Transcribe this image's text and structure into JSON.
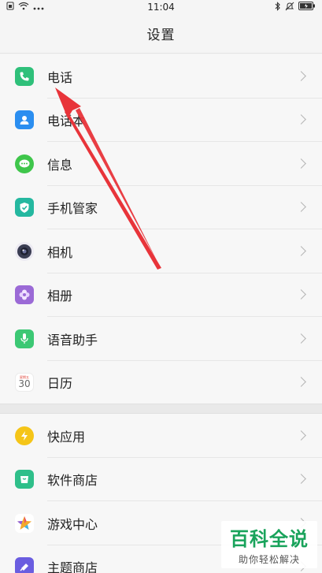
{
  "status_bar": {
    "time": "11:04",
    "left_icons": [
      "sim-icon",
      "wifi-icon",
      "more-dots-icon"
    ],
    "right_icons": [
      "bluetooth-icon",
      "mute-icon",
      "battery-icon"
    ]
  },
  "header": {
    "title": "设置"
  },
  "groups": [
    {
      "items": [
        {
          "label": "电话",
          "icon": "phone-icon",
          "color": "#2fc07a"
        },
        {
          "label": "电话本",
          "icon": "contacts-icon",
          "color": "#2b8ef0"
        },
        {
          "label": "信息",
          "icon": "messages-icon",
          "color": "#3fc64b"
        },
        {
          "label": "手机管家",
          "icon": "phone-manager-icon",
          "color": "#25b8a0"
        },
        {
          "label": "相机",
          "icon": "camera-icon",
          "color": "#3a3d52"
        },
        {
          "label": "相册",
          "icon": "gallery-icon",
          "color": "#9b6ad6"
        },
        {
          "label": "语音助手",
          "icon": "voice-assistant-icon",
          "color": "#3cc874"
        },
        {
          "label": "日历",
          "icon": "calendar-icon",
          "color": "#ffffff",
          "calendar_day": "30",
          "calendar_top": "星期五"
        }
      ]
    },
    {
      "items": [
        {
          "label": "快应用",
          "icon": "quick-app-icon",
          "color": "#f5c518"
        },
        {
          "label": "软件商店",
          "icon": "app-store-icon",
          "color": "#2fbf8a"
        },
        {
          "label": "游戏中心",
          "icon": "game-center-icon",
          "color": "#ffffff"
        },
        {
          "label": "主题商店",
          "icon": "theme-store-icon",
          "color": "#6a5de0"
        }
      ]
    }
  ],
  "annotation": {
    "arrow_color": "#e8343a"
  },
  "watermark": {
    "main": "百科全说",
    "sub": "助你轻松解决"
  }
}
